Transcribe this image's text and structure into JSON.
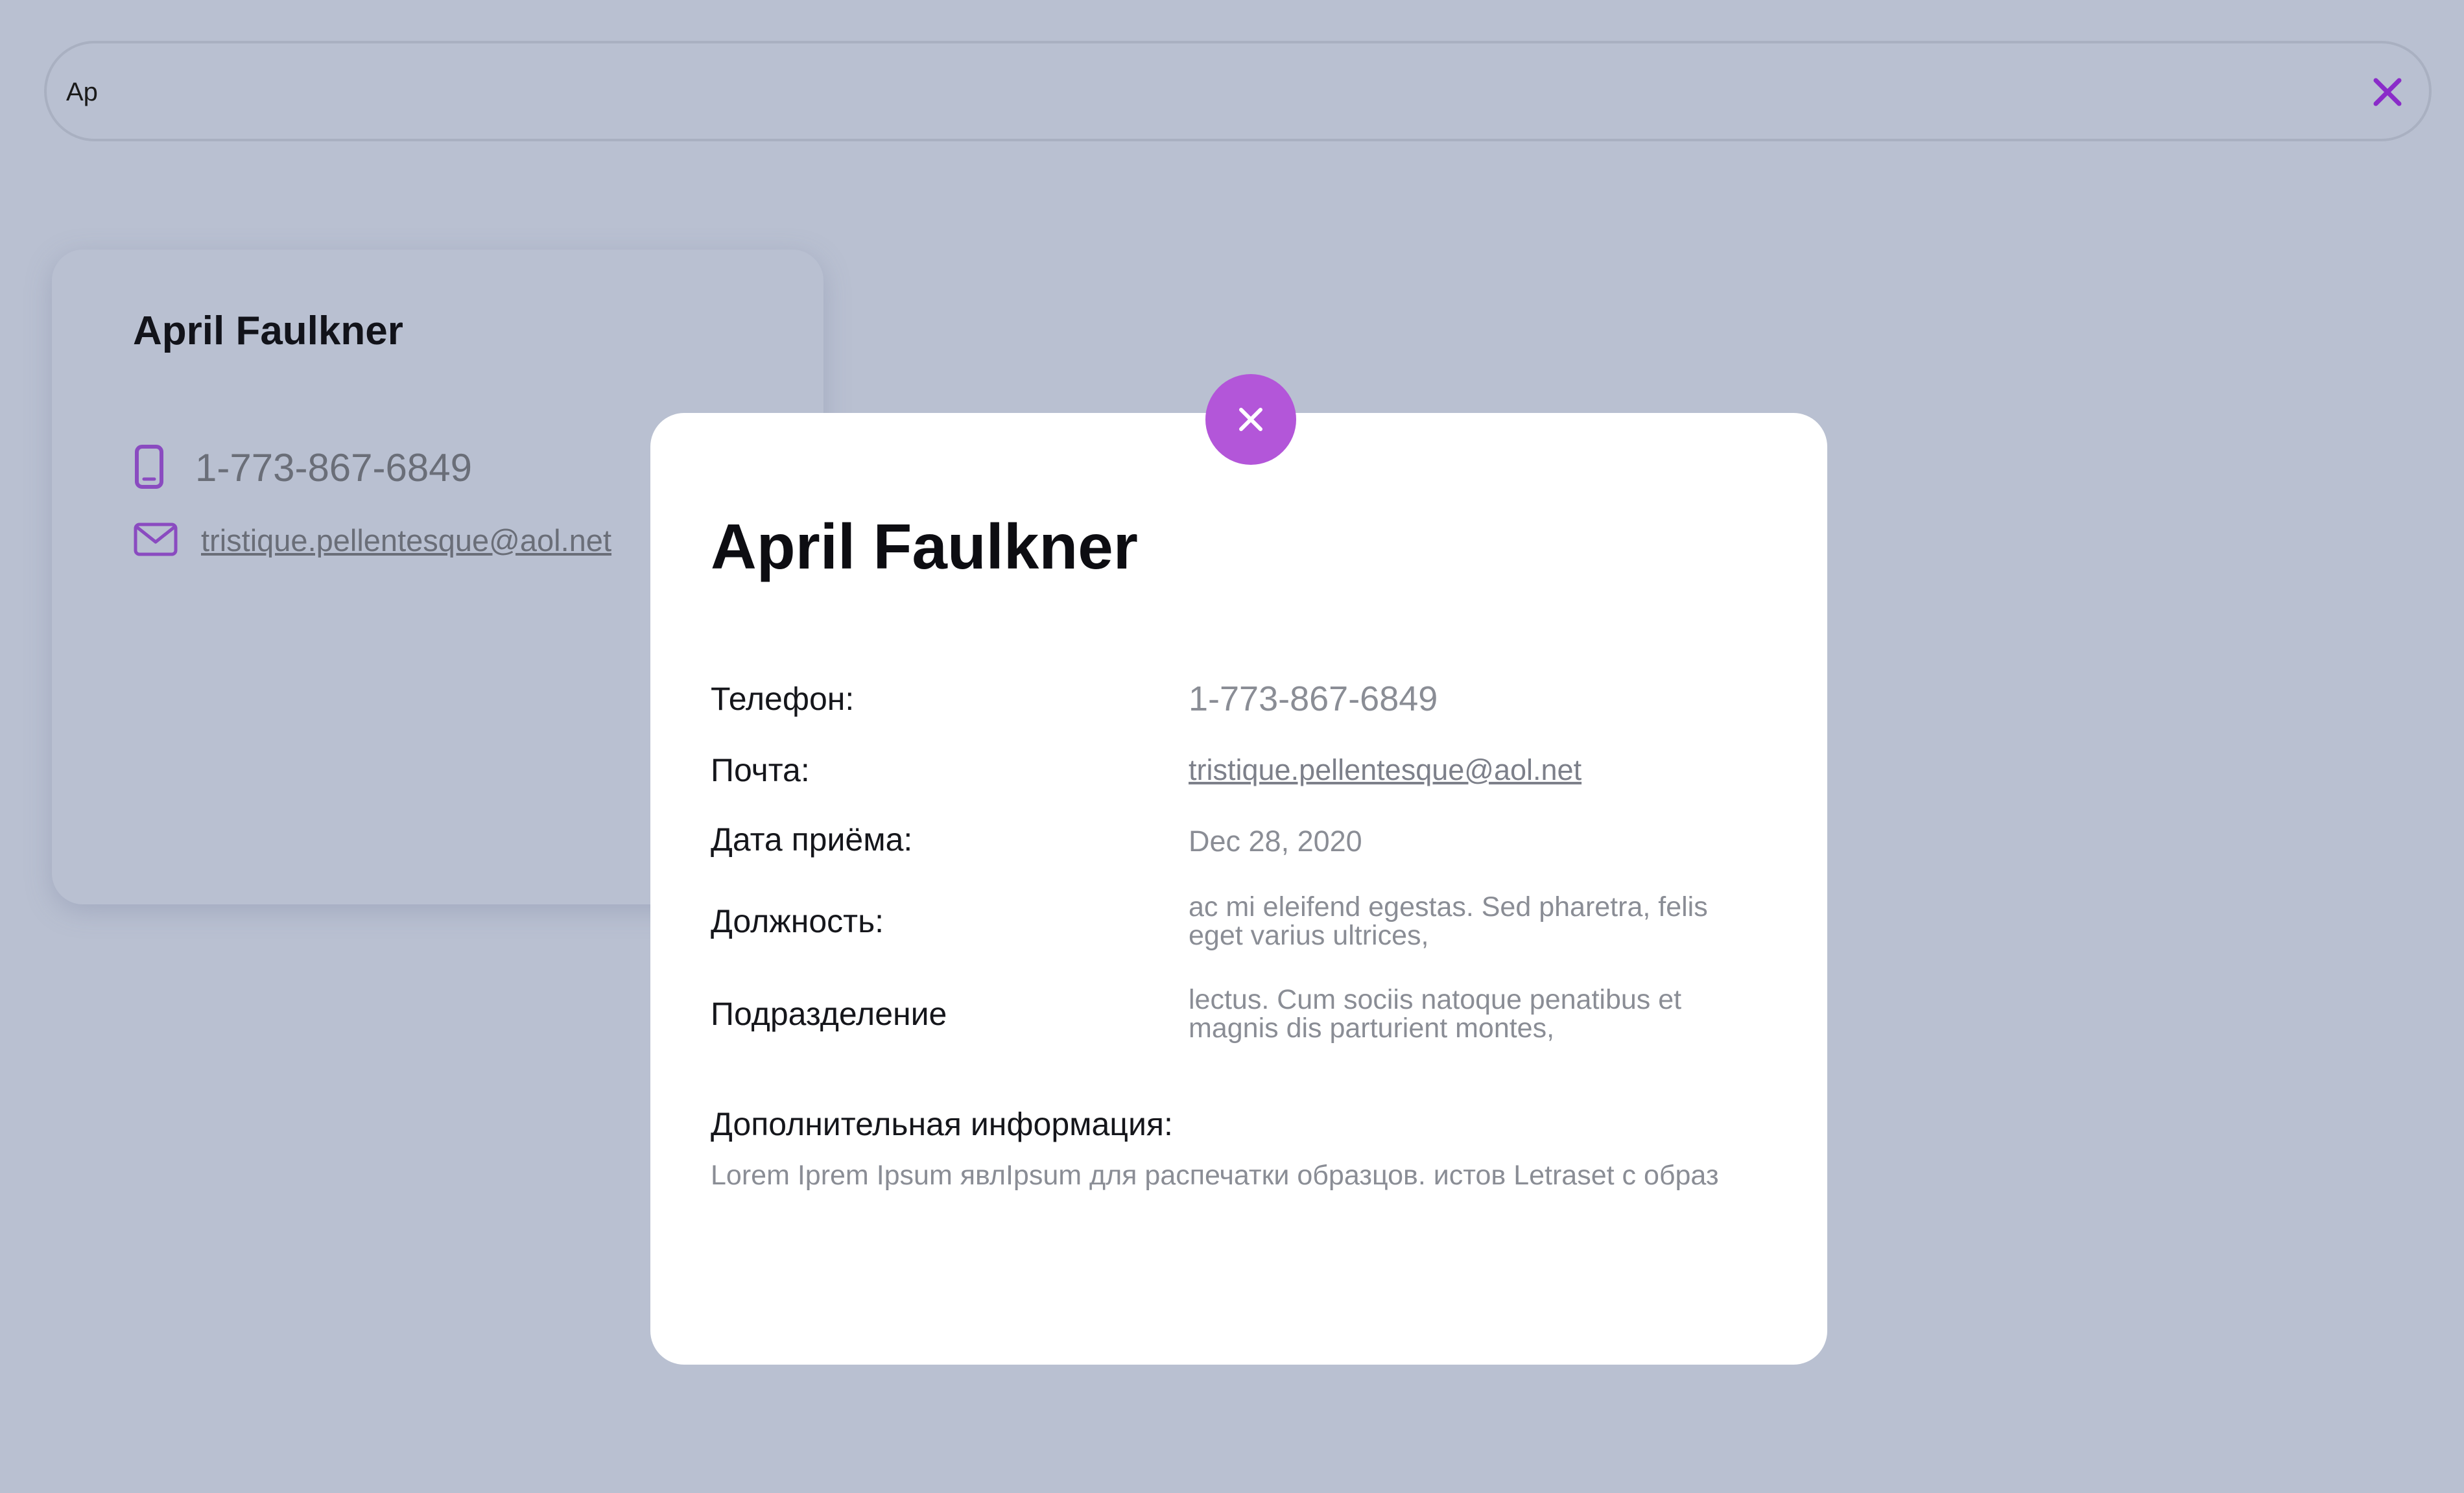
{
  "search": {
    "value": "Ap",
    "clear_icon": "close-icon",
    "clear_color": "#8a2cc9"
  },
  "card": {
    "name": "April Faulkner",
    "phone": "1-773-867-6849",
    "email": "tristique.pellentesque@aol.net",
    "phone_icon": "phone-icon",
    "email_icon": "mail-icon",
    "icon_color": "#8a4bc0"
  },
  "modal": {
    "close_icon": "close-icon",
    "accent": "#b356d9",
    "title": "April Faulkner",
    "fields": [
      {
        "label": "Телефон:",
        "value": "1-773-867-6849"
      },
      {
        "label": "Почта:",
        "value": "tristique.pellentesque@aol.net"
      },
      {
        "label": "Дата приёма:",
        "value": "Dec 28, 2020"
      },
      {
        "label": "Должность:",
        "value": "ac mi eleifend egestas. Sed pharetra, felis eget varius ultrices,"
      },
      {
        "label": "Подразделение",
        "value": "lectus. Cum sociis natoque penatibus et magnis dis parturient montes,"
      }
    ],
    "extra_label": "Дополнительная информация:",
    "extra_text": "Lorem Iprem Ipsum явлIpsum для распечатки образцов. истов Letraset с образ"
  }
}
